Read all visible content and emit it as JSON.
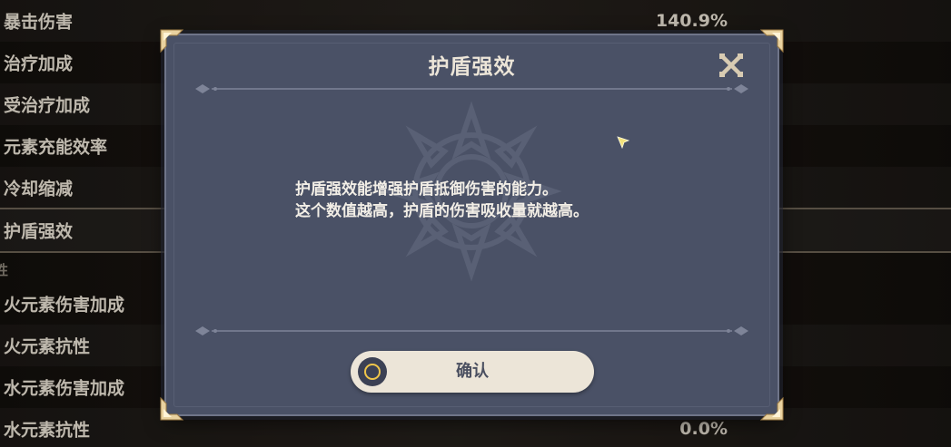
{
  "stats": [
    {
      "label": "暴击伤害",
      "value": "140.9%"
    },
    {
      "label": "治疗加成",
      "value": ""
    },
    {
      "label": "受治疗加成",
      "value": ""
    },
    {
      "label": "元素充能效率",
      "value": ""
    },
    {
      "label": "冷却缩减",
      "value": ""
    },
    {
      "label": "护盾强效",
      "value": ""
    },
    {
      "label": "火元素伤害加成",
      "value": ""
    },
    {
      "label": "火元素抗性",
      "value": ""
    },
    {
      "label": "水元素伤害加成",
      "value": ""
    },
    {
      "label": "水元素抗性",
      "value": "0.0%"
    }
  ],
  "section_header": "性",
  "dialog": {
    "title": "护盾强效",
    "body_line1": "护盾强效能增强护盾抵御伤害的能力。",
    "body_line2": "这个数值越高，护盾的伤害吸收量就越高。",
    "confirm_label": "确认"
  },
  "icons": {
    "close": "close-icon",
    "confirm": "circle-button-icon",
    "corner": "corner-ornament-icon",
    "cursor": "star-cursor-icon"
  },
  "colors": {
    "dialog_bg": "#4a5166",
    "text_light": "#ece5d8",
    "button_bg": "#ece5d8",
    "accent_gold": "#f0c64a"
  }
}
